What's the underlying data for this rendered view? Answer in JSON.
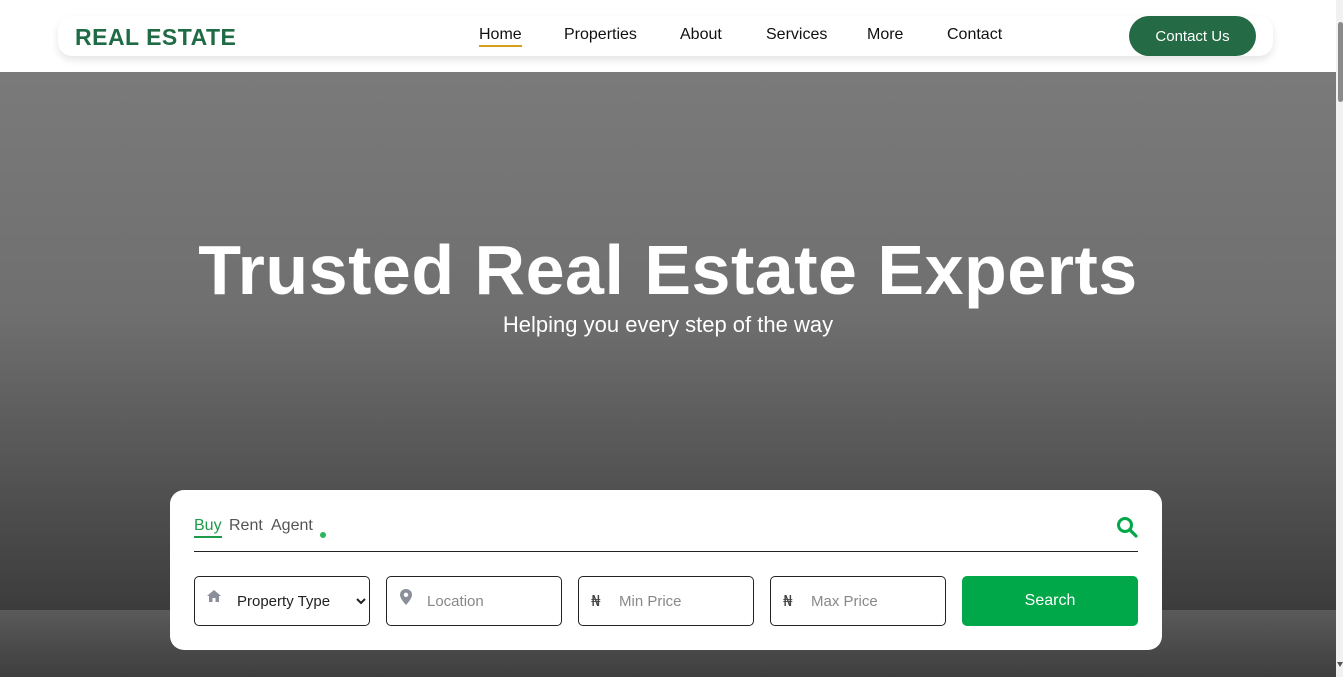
{
  "header": {
    "logo": "REAL ESTATE",
    "nav": [
      "Home",
      "Properties",
      "About",
      "Services",
      "More",
      "Contact"
    ],
    "active_nav": "Home",
    "contact_button": "Contact Us"
  },
  "hero": {
    "title": "Trusted Real Estate Experts",
    "subtitle": "Helping you every step of the way"
  },
  "search": {
    "tabs": [
      "Buy",
      "Rent",
      "Agent"
    ],
    "active_tab": "Buy",
    "property_type": "Property Type",
    "location_placeholder": "Location",
    "min_price_placeholder": "Min Price",
    "max_price_placeholder": "Max Price",
    "currency_symbol": "₦",
    "search_button": "Search"
  },
  "icons": {
    "search": "search-icon",
    "property": "home-icon",
    "location": "map-pin-icon"
  },
  "colors": {
    "brand_green": "#1f6b45",
    "button_green": "#246a45",
    "search_green": "#00a849",
    "active_tab": "#1e9b4a",
    "nav_underline": "#d4a017"
  }
}
